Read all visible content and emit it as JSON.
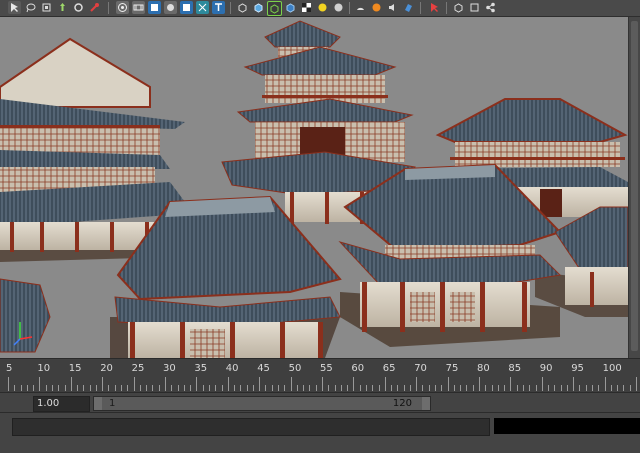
{
  "toolbar": {
    "icons": [
      "select-icon",
      "lasso-icon",
      "paint-icon",
      "move-icon",
      "rotate-icon",
      "scale-icon",
      "camera-icon",
      "film-icon",
      "grid-icon",
      "wire-icon",
      "smooth-icon",
      "texture-icon",
      "light-icon",
      "text-icon",
      "isolate-icon",
      "box-icon",
      "cube-icon",
      "xray-icon",
      "shaded-icon",
      "bulb-icon",
      "sphere-icon",
      "ambient-icon",
      "render-icon",
      "sound-icon",
      "hypershade-icon",
      "snap-icon",
      "object-icon",
      "node-icon"
    ],
    "accent": "#3aa0d8"
  },
  "viewport": {
    "background": "#8a8a8a",
    "axis_colors": {
      "x": "#ff3030",
      "y": "#40e040",
      "z": "#4080ff"
    }
  },
  "timeline": {
    "ticks": [
      "5",
      "10",
      "15",
      "20",
      "25",
      "30",
      "35",
      "40",
      "45",
      "50",
      "55",
      "60",
      "65",
      "70",
      "75",
      "80",
      "85",
      "90",
      "95",
      "100"
    ]
  },
  "range": {
    "current_value": "1.00",
    "slider_start": "1",
    "slider_end": "120"
  }
}
